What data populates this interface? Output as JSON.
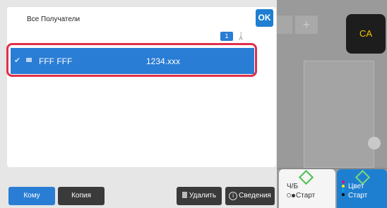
{
  "dialog": {
    "title": "Все Получатели",
    "ok_label": "OK",
    "page_number": "1",
    "sort_icon": "sort-az-icon"
  },
  "recipients": [
    {
      "name": "FFF FFF",
      "address": "1234.xxx",
      "selected": true
    }
  ],
  "bottom": {
    "to_label": "Кому",
    "copy_label": "Копия",
    "delete_label": "Удалить",
    "info_label": "Сведения"
  },
  "side": {
    "ca_label": "CA",
    "bw_label": "Ч/Б",
    "bw_start": "Старт",
    "color_label": "Цвет",
    "color_start": "Старт"
  },
  "colors": {
    "accent": "#1e7fd0",
    "highlight": "#e0304a",
    "ca_text": "#f5c400"
  }
}
